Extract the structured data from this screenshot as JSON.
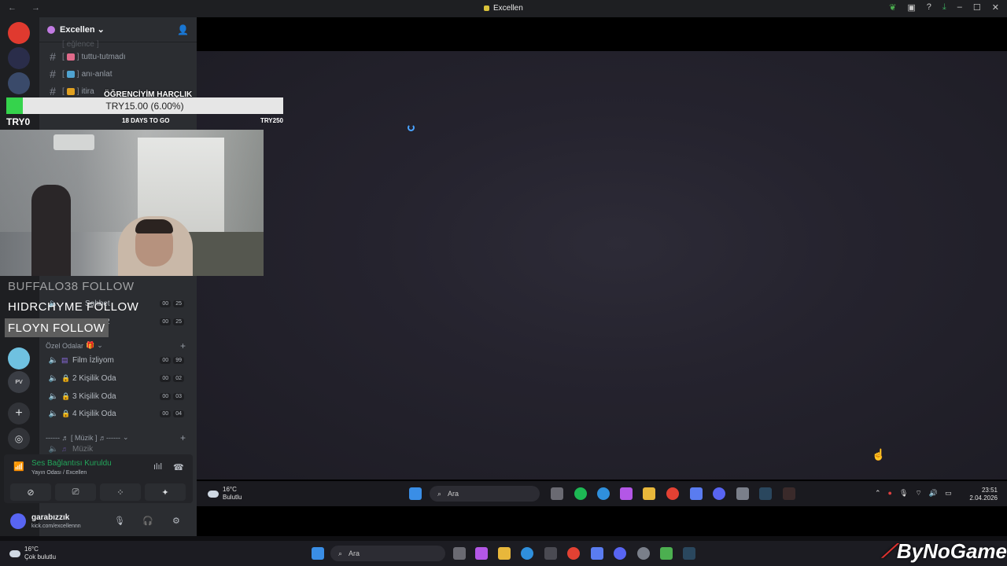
{
  "titlebar": {
    "title": "Excellen"
  },
  "server": {
    "name": "Excellen"
  },
  "channels": [
    {
      "name": "eğlence",
      "faded": true
    },
    {
      "name": "tuttu-tutmadı",
      "color": "#e06a8a"
    },
    {
      "name": "anı-anlat",
      "color": "#4fa3d1"
    },
    {
      "name": "itira",
      "color": "#e0a020"
    }
  ],
  "voice_channels_upper": [
    {
      "name": "Sohbet",
      "a": "00",
      "b": "25"
    },
    {
      "name": "2",
      "a": "00",
      "b": "25"
    }
  ],
  "category_private": "Özel Odalar",
  "voice_channels": [
    {
      "name": "Film İzliyom",
      "a": "00",
      "b": "99"
    },
    {
      "name": "2 Kişilik Oda",
      "a": "00",
      "b": "02"
    },
    {
      "name": "3 Kişilik Oda",
      "a": "00",
      "b": "03"
    },
    {
      "name": "4 Kişilik Oda",
      "a": "00",
      "b": "04"
    }
  ],
  "category_music": "------ ♬ [ Müzik ] ♬------",
  "music_channel": "Müzik",
  "voice_panel": {
    "status": "Ses Bağlantısı Kuruldu",
    "sub": "Yayın Odası / Excellen"
  },
  "user": {
    "name": "garabızzık",
    "status": "kick.com/excellennn"
  },
  "goal": {
    "title": "ÖĞRENCİYİM HARÇLIK",
    "amount": "TRY15.00 (6.00%)",
    "progress": 0.06,
    "min": "TRY0",
    "days": "18 DAYS TO GO",
    "max": "TRY250"
  },
  "followers": [
    {
      "text": "BUFFALO38  FOLLOW",
      "style": "faded"
    },
    {
      "text": "HIDRCHYME  FOLLOW",
      "style": "plain"
    },
    {
      "text": "FLOYN  FOLLOW",
      "style": "box"
    }
  ],
  "inner_taskbar": {
    "weather_temp": "16°C",
    "weather_desc": "Bulutlu",
    "search_placeholder": "Ara",
    "time": "23:51",
    "date": "2.04.2026"
  },
  "outer_taskbar": {
    "weather_temp": "16°C",
    "weather_desc": "Çok bulutlu",
    "search_placeholder": "Ara"
  },
  "watermark": "ByNoGame"
}
